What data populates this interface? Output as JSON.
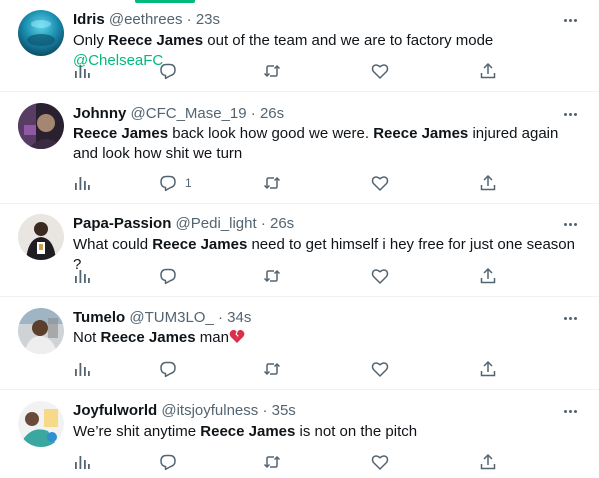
{
  "tweets": [
    {
      "name": "Idris",
      "handle": "@eethrees",
      "separator": "·",
      "time": "23s",
      "text_parts": [
        {
          "t": "Only ",
          "style": "normal"
        },
        {
          "t": "Reece James",
          "style": "bold"
        },
        {
          "t": " out of the team and we are to factory mode ",
          "style": "normal"
        },
        {
          "t": "@ChelseaFC",
          "style": "mention"
        }
      ],
      "reply_count": ""
    },
    {
      "name": "Johnny",
      "handle": "@CFC_Mase_19",
      "separator": "·",
      "time": "26s",
      "text_parts": [
        {
          "t": "Reece James",
          "style": "bold"
        },
        {
          "t": " back look how good we were. ",
          "style": "normal"
        },
        {
          "t": "Reece James",
          "style": "bold"
        },
        {
          "t": " injured again and look how shit we turn",
          "style": "normal"
        }
      ],
      "reply_count": "1"
    },
    {
      "name": "Papa-Passion",
      "handle": "@Pedi_light",
      "separator": "·",
      "time": "26s",
      "text_parts": [
        {
          "t": "What could ",
          "style": "normal"
        },
        {
          "t": "Reece James",
          "style": "bold"
        },
        {
          "t": " need to get himself i hey free for just one season ?",
          "style": "normal"
        }
      ],
      "reply_count": ""
    },
    {
      "name": "Tumelo",
      "handle": "@TUM3LO_",
      "separator": "·",
      "time": "34s",
      "text_parts": [
        {
          "t": "Not ",
          "style": "normal"
        },
        {
          "t": "Reece James",
          "style": "bold"
        },
        {
          "t": " man",
          "style": "normal"
        }
      ],
      "has_broken_heart": true,
      "reply_count": ""
    },
    {
      "name": "Joyfulworld",
      "handle": "@itsjoyfulness",
      "separator": "·",
      "time": "35s",
      "text_parts": [
        {
          "t": "We’re shit anytime ",
          "style": "normal"
        },
        {
          "t": "Reece James",
          "style": "bold"
        },
        {
          "t": " is not on the pitch",
          "style": "normal"
        }
      ],
      "reply_count": ""
    }
  ],
  "colors": {
    "accent": "#00ba7c",
    "text": "#0f1419",
    "muted": "#536471",
    "divider": "#eff3f4",
    "broken_heart": "#d9304b"
  },
  "icons": [
    "views-icon",
    "reply-icon",
    "retweet-icon",
    "like-icon",
    "share-icon",
    "more-icon",
    "broken-heart-emoji"
  ]
}
